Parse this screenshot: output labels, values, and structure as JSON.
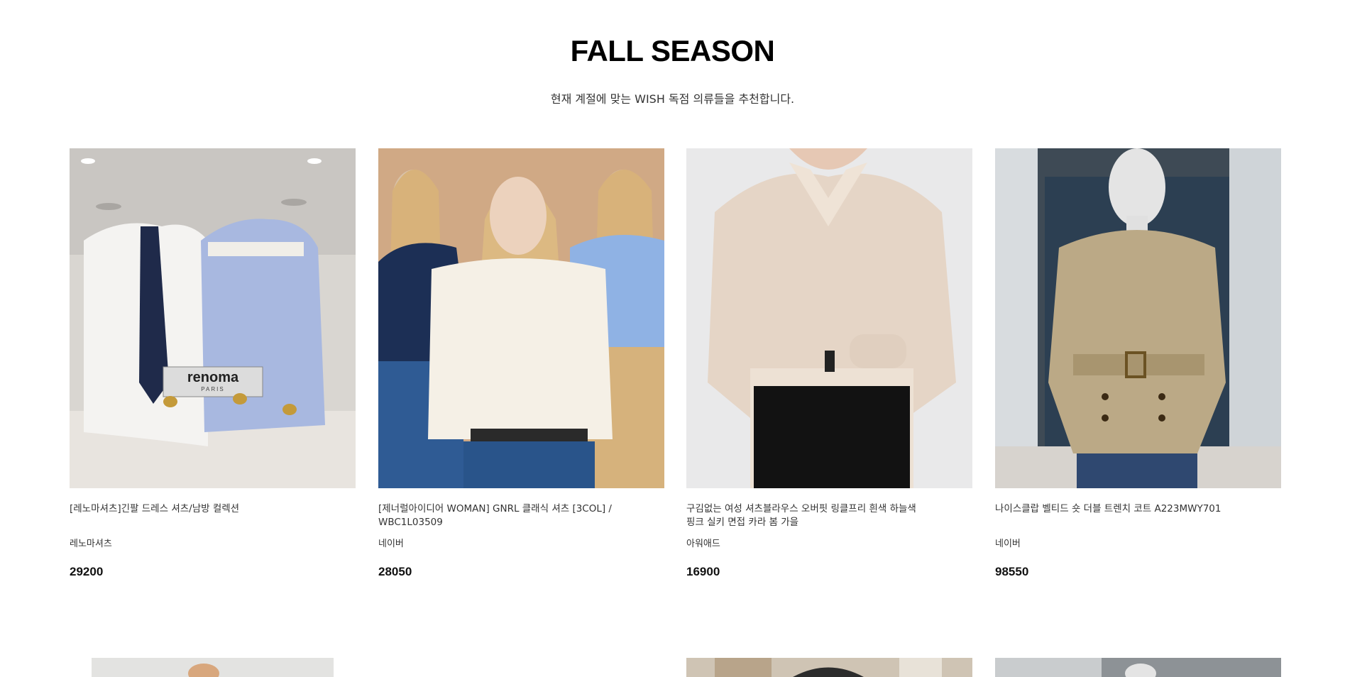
{
  "section": {
    "title": "FALL SEASON",
    "subtitle": "현재 계절에 맞는 WISH 독점 의류들을 추천합니다."
  },
  "products": [
    {
      "name": "[레노마셔츠]긴팔 드레스 셔츠/남방 컬렉션",
      "brand": "레노마셔츠",
      "price": "29200",
      "image_logo": "renoma PARIS"
    },
    {
      "name": "[제너럴아이디어 WOMAN] GNRL 클래식 셔츠 [3COL] /\nWBC1L03509",
      "brand": "네이버",
      "price": "28050"
    },
    {
      "name": "구김없는 여성 셔츠블라우스 오버핏 링클프리 흰색 하늘색\n핑크 실키 면접 카라 봄 가을",
      "brand": "아워애드",
      "price": "16900"
    },
    {
      "name": "나이스클랍 벨티드 숏 더블 트렌치 코트 A223MWY701",
      "brand": "네이버",
      "price": "98550"
    }
  ],
  "colors": {
    "background": "#ffffff",
    "title": "#000000",
    "text": "#333333"
  }
}
